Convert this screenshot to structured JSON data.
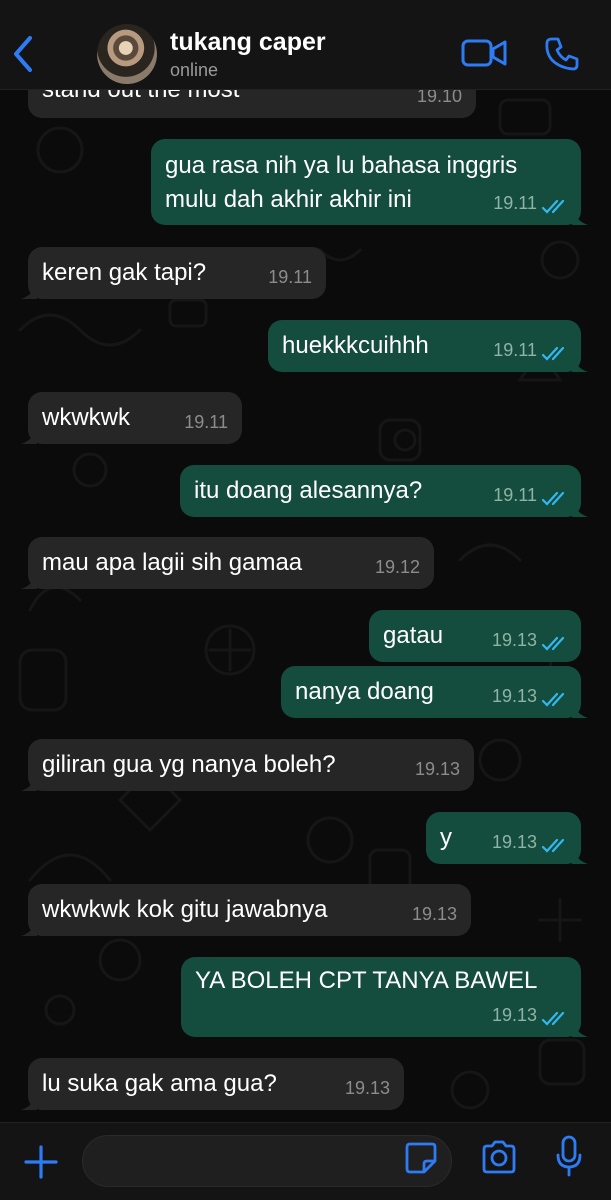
{
  "header": {
    "contact_name": "tukang caper",
    "status": "online",
    "icons": {
      "back": "chevron-left-icon",
      "video": "video-camera-icon",
      "call": "phone-icon"
    },
    "accent_color": "#2d7cf6"
  },
  "messages": [
    {
      "side": "in",
      "text": "stand out the most",
      "time": "19.10"
    },
    {
      "side": "out",
      "text": "gua rasa nih ya lu bahasa inggris mulu dah akhir akhir ini",
      "time": "19.11",
      "read": true
    },
    {
      "side": "in",
      "text": "keren gak tapi?",
      "time": "19.11"
    },
    {
      "side": "out",
      "text": "huekkkcuihhh",
      "time": "19.11",
      "read": true
    },
    {
      "side": "in",
      "text": "wkwkwk",
      "time": "19.11"
    },
    {
      "side": "out",
      "text": "itu doang alesannya?",
      "time": "19.11",
      "read": true
    },
    {
      "side": "in",
      "text": "mau apa lagii sih gamaa",
      "time": "19.12"
    },
    {
      "side": "out",
      "text": "gatau",
      "time": "19.13",
      "read": true
    },
    {
      "side": "out",
      "text": "nanya doang",
      "time": "19.13",
      "read": true
    },
    {
      "side": "in",
      "text": "giliran gua yg nanya boleh?",
      "time": "19.13"
    },
    {
      "side": "out",
      "text": "y",
      "time": "19.13",
      "read": true
    },
    {
      "side": "in",
      "text": "wkwkwk kok gitu jawabnya",
      "time": "19.13"
    },
    {
      "side": "out",
      "text": "YA BOLEH CPT TANYA BAWEL",
      "time": "19.13",
      "read": true
    },
    {
      "side": "in",
      "text": "lu suka gak ama gua?",
      "time": "19.13"
    }
  ],
  "composer": {
    "placeholder": "",
    "icons": {
      "add": "plus-icon",
      "sticker": "sticker-icon",
      "camera": "camera-icon",
      "mic": "microphone-icon"
    }
  },
  "colors": {
    "incoming_bubble": "#262626",
    "outgoing_bubble": "#144d3d",
    "read_ticks": "#34b7f1"
  }
}
